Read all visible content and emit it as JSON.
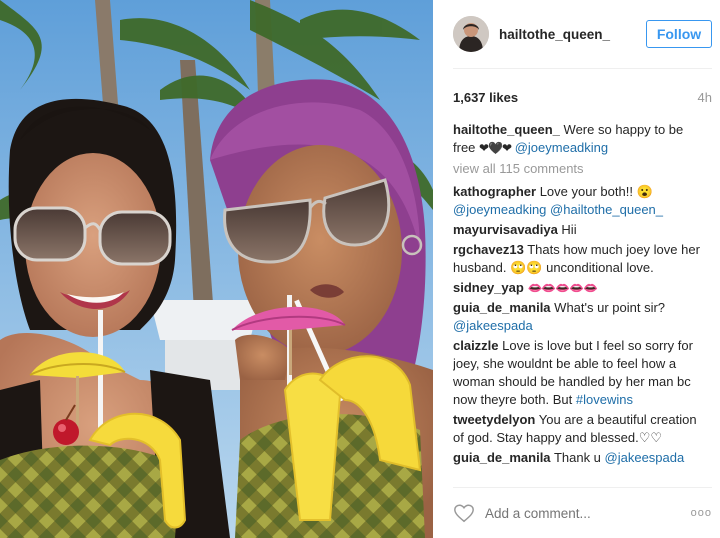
{
  "author": {
    "username": "hailtothe_queen_",
    "follow_label": "Follow"
  },
  "stats": {
    "likes": "1,637 likes",
    "time": "4h"
  },
  "caption": {
    "username": "hailtothe_queen_",
    "text": "Were so happy to be free",
    "emoji": "❤🖤❤",
    "mention": "@joeymeadking"
  },
  "view_all": "view all 115 comments",
  "comments": [
    {
      "username": "kathographer",
      "parts": [
        {
          "t": "text",
          "v": "Love your both!! 😮"
        },
        {
          "t": "mention",
          "v": "@joeymeadking"
        },
        {
          "t": "text",
          "v": " "
        },
        {
          "t": "mention",
          "v": "@hailtothe_queen_"
        }
      ]
    },
    {
      "username": "mayurvisavadiya",
      "parts": [
        {
          "t": "text",
          "v": "Hii"
        }
      ]
    },
    {
      "username": "rgchavez13",
      "parts": [
        {
          "t": "text",
          "v": "Thats how much joey love her husband. 🙄🙄 unconditional love."
        }
      ]
    },
    {
      "username": "sidney_yap",
      "parts": [
        {
          "t": "emoji",
          "v": "👄👄👄👄👄"
        }
      ]
    },
    {
      "username": "guia_de_manila",
      "parts": [
        {
          "t": "text",
          "v": "What's ur point sir? "
        },
        {
          "t": "mention",
          "v": "@jakeespada"
        }
      ]
    },
    {
      "username": "claizzle",
      "parts": [
        {
          "t": "text",
          "v": "Love is love but I feel so sorry for joey, she wouldnt be able to feel how a woman should be handled by her man bc now theyre both. But "
        },
        {
          "t": "mention",
          "v": "#lovewins"
        }
      ]
    },
    {
      "username": "tweetydelyon",
      "parts": [
        {
          "t": "text",
          "v": "You are a beautiful creation of god. Stay happy and blessed.♡♡"
        }
      ]
    },
    {
      "username": "guia_de_manila",
      "parts": [
        {
          "t": "text",
          "v": "Thank u "
        },
        {
          "t": "mention",
          "v": "@jakeespada"
        }
      ]
    }
  ],
  "footer": {
    "placeholder": "Add a comment...",
    "more": "ooo"
  },
  "colors": {
    "accent": "#3897f0",
    "mention": "#1f6ea8",
    "muted": "#999999",
    "text": "#262626"
  },
  "icons": {
    "like": "heart-outline-icon",
    "more": "more-options-icon"
  }
}
